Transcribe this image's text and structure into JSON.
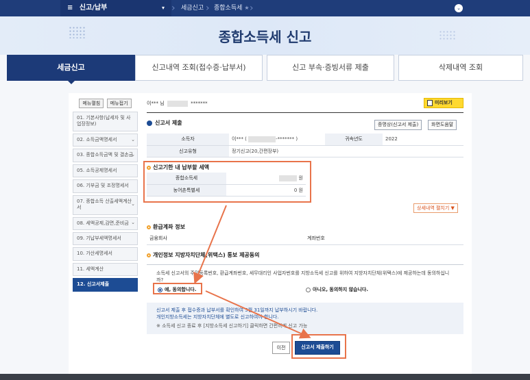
{
  "topnav": {
    "menu_label": "신고/납부",
    "crumbs": [
      "세금신고",
      "종합소득세"
    ]
  },
  "hero": {
    "title": "종합소득세 신고"
  },
  "tabs": [
    "세금신고",
    "신고내역 조회(접수증·납부서)",
    "신고 부속·증빙서류 제출",
    "삭제내역 조회"
  ],
  "sidebar": {
    "expand_all": "메뉴펼침",
    "collapse_all": "메뉴접기",
    "items": [
      "01. 기본사항(납세자 및 사업장정보)",
      "02. 소득금액명세서",
      "03. 종합소득금액 및 결손금",
      "05. 소득공제명세서",
      "06. 기부금 및 조정명세서",
      "07. 종합소득 산출세액계산서",
      "08. 세액공제,감면,준비금",
      "09. 기납부세액명세서",
      "10. 가산세명세서",
      "11. 세액계산",
      "12. 신고서제출"
    ]
  },
  "main": {
    "user_prefix": "이*** 님",
    "user_masked": "*******",
    "preview_label": "미리보기",
    "section_submit": "신고서 제출",
    "btn_print_certificate": "증명상(신고서 제출)",
    "btn_screen_help": "화면도움말",
    "info_table": {
      "taxpayer_label": "소득자",
      "taxpayer_value": "이*** (",
      "taxpayer_masked": "-******* )",
      "year_label": "귀속년도",
      "year_value": "2022",
      "type_label": "신고유형",
      "type_value": "정기신고(20,간편장부)"
    },
    "section_tax": "신고기한 내 납부할 세액",
    "tax_rows": [
      {
        "label": "종합소득세",
        "value": "원"
      },
      {
        "label": "농어촌특별세",
        "value": "0 원"
      }
    ],
    "detail_toggle": "상세내역 펼치기 ▼",
    "section_refund": "환급계좌 정보",
    "refund_table": {
      "bank_label": "금융회사",
      "account_label": "계좌번호"
    },
    "section_consent": "개인정보 지방자치단체(위택스) 통보 제공동의",
    "consent_text": "소득세 신고서의 주민등록번호, 환급계좌번호, 세무대리인 사업자번호를 지방소득세 신고를 위하여 지방자치단체(위택스)에 제공하는데 동의하십니까?",
    "consent_yes": "예, 동의합니다.",
    "consent_no": "아니오, 동의하지 않습니다.",
    "notice_line1": "신고서 제출 후 접수증과 납부서를 확인하여 5월 31일까지 납부하시기 바랍니다.",
    "notice_line2": "개인지방소득세는 지방자치단체에 별도로 신고하여야 합니다.",
    "notice_small": "※ 소득세 신고 종료 후 [지방소득세 신고하기] 클릭하면 간편하게 신고 가능",
    "btn_prev": "이전",
    "btn_submit": "신고서 제출하기"
  },
  "colors": {
    "navy": "#1f3d7a",
    "accent_orange": "#e8734a",
    "preview_yellow": "#ffd930"
  }
}
